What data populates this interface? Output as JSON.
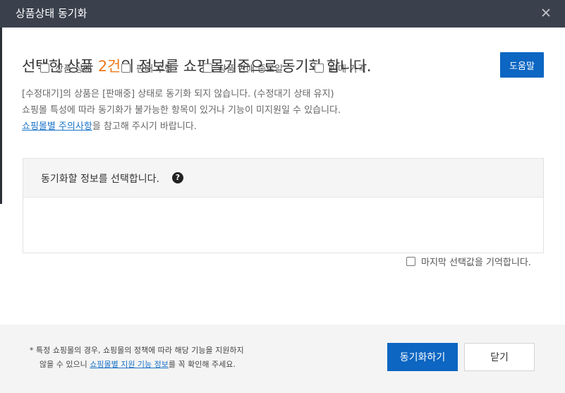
{
  "dialog": {
    "title": "상품상태 동기화"
  },
  "headline": {
    "prefix": "선택한 상품 ",
    "count": "2건",
    "suffix": "의 정보를 쇼핑몰기준으로 동기화 합니다."
  },
  "help_label": "도움말",
  "notes": {
    "line1": "[수정대기]의 상품은 [판매중] 상태로 동기화 되지 않습니다. (수정대기 상태 유지)",
    "line2": "쇼핑몰 특성에 따라 동기화가 불가능한 항목이 있거나 기능이 미지원일 수 있습니다.",
    "link": "쇼핑몰별 주의사항",
    "line3_rest": "을 참고해 주시기 바랍니다."
  },
  "panel": {
    "label": "동기화할 정보를 선택합니다.",
    "help_glyph": "?",
    "options": [
      {
        "label": "상품 상태",
        "checked": false
      },
      {
        "label": "판매 수량",
        "checked": false
      },
      {
        "label": "상품 판매 종료일",
        "checked": false
      },
      {
        "label": "판매 가격",
        "checked": false
      }
    ]
  },
  "remember": {
    "label": "마지막 선택값을 기억합니다.",
    "checked": false
  },
  "footer": {
    "note_line1": "*  특정 쇼핑몰의 경우, 쇼핑몰의 정책에 따라 해당 기능을 지원하지",
    "note_line2_prefix": "않을 수 있으니 ",
    "note_link": "쇼핑몰별 지원 기능 정보",
    "note_line2_suffix": "를 꼭 확인해 주세요.",
    "sync_label": "동기화하기",
    "close_label": "닫기"
  },
  "colors": {
    "titlebar": "#3a414d",
    "primary": "#0c66c2",
    "count_accent": "#f07a1e",
    "link": "#1a73c8"
  }
}
